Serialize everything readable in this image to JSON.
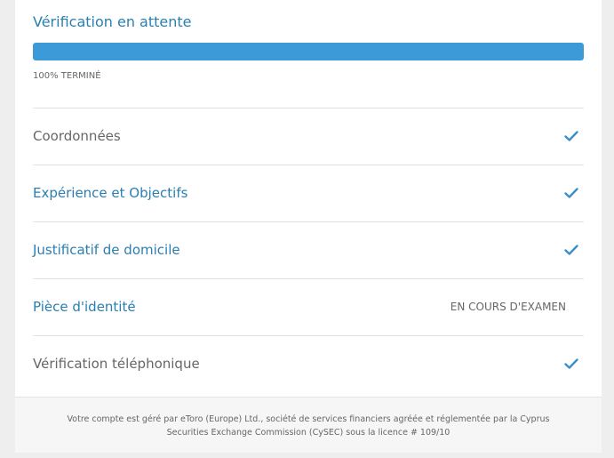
{
  "colors": {
    "accent": "#3d9ad9",
    "link": "#2a7fb0",
    "text": "#666666",
    "check": "#3d8fc8"
  },
  "verification": {
    "title": "Vérification en attente",
    "progress_percent": 100,
    "progress_label": "100% TERMINÉ"
  },
  "steps": [
    {
      "label": "Coordonnées",
      "style": "plain",
      "status": "done",
      "icon": "check-icon"
    },
    {
      "label": "Expérience et Objectifs",
      "style": "link",
      "status": "done",
      "icon": "check-icon"
    },
    {
      "label": "Justificatif de domicile",
      "style": "link",
      "status": "done",
      "icon": "check-icon"
    },
    {
      "label": "Pièce d'identité",
      "style": "link",
      "status": "pending",
      "status_text": "EN COURS D'EXAMEN"
    },
    {
      "label": "Vérification téléphonique",
      "style": "plain",
      "status": "done",
      "icon": "check-icon"
    }
  ],
  "footer": {
    "line1": "Votre compte est géré par eToro (Europe) Ltd., société de services financiers agréée et réglementée par la Cyprus",
    "line2": "Securities Exchange Commission (CySEC) sous la licence # 109/10"
  }
}
